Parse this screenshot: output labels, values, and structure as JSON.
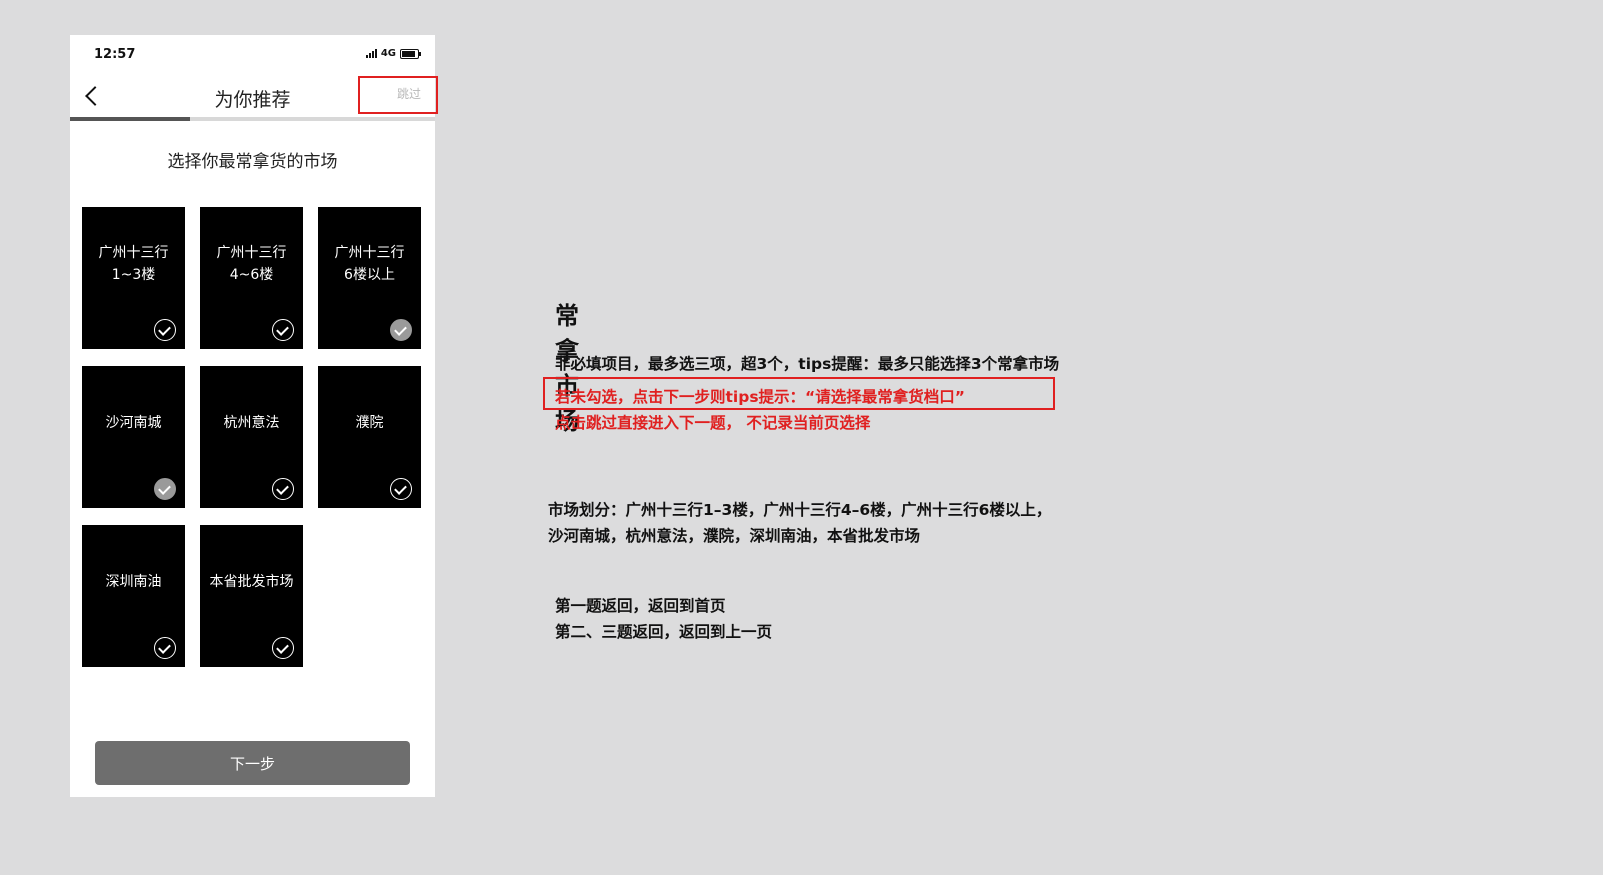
{
  "status_bar": {
    "time": "12:57",
    "network": "4G"
  },
  "nav": {
    "title": "为你推荐",
    "skip_label": "跳过"
  },
  "progress": {
    "fraction": 0.33
  },
  "question": "选择你最常拿货的市场",
  "tiles": [
    {
      "label": "广州十三行\n1~3楼",
      "checked": false
    },
    {
      "label": "广州十三行\n4~6楼",
      "checked": false
    },
    {
      "label": "广州十三行\n6楼以上",
      "checked": true
    },
    {
      "label": "沙河南城",
      "checked": true
    },
    {
      "label": "杭州意法",
      "checked": false
    },
    {
      "label": "濮院",
      "checked": false
    },
    {
      "label": "深圳南油",
      "checked": false
    },
    {
      "label": "本省批发市场",
      "checked": false
    }
  ],
  "next_button": "下一步",
  "notes": {
    "title": "常拿市场",
    "rule_line": "非必填项目，最多选三项，超3个，tips提醒：最多只能选择3个常拿市场",
    "red_line_1": "若未勾选，点击下一步则tips提示：“请选择最常拿货档口”",
    "red_line_2": "点击跳过直接进入下一题， 不记录当前页选择",
    "market_line_1": "市场划分：广州十三行1–3楼，广州十三行4–6楼，广州十三行6楼以上，",
    "market_line_2": "沙河南城，杭州意法，濮院，深圳南油，本省批发市场",
    "back_line_1": "第一题返回，返回到首页",
    "back_line_2": "第二、三题返回，返回到上一页"
  },
  "colors": {
    "accent_red": "#e02020",
    "tile_bg": "#000000",
    "button_bg": "#6e6e6e"
  }
}
